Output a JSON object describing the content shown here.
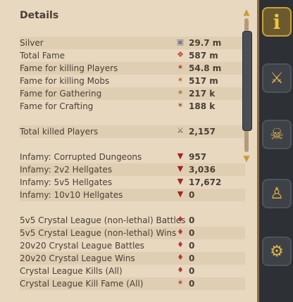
{
  "panel": {
    "title": "Details",
    "rows": [
      {
        "label": "Silver",
        "value": "29.7 m",
        "icon": "silver-icon"
      },
      {
        "label": "Total Fame",
        "value": "587 m",
        "icon": "fame-icon"
      },
      {
        "label": "Fame for killing Players",
        "value": "54.8 m",
        "icon": "pvp-fame-icon"
      },
      {
        "label": "Fame for killing Mobs",
        "value": "517 m",
        "icon": "pve-fame-icon"
      },
      {
        "label": "Fame for Gathering",
        "value": "217 k",
        "icon": "gathering-fame-icon"
      },
      {
        "label": "Fame for Crafting",
        "value": "188 k",
        "icon": "crafting-fame-icon"
      },
      {
        "label": "Total killed Players",
        "value": "2,157",
        "icon": "swords-icon"
      },
      {
        "label": "Infamy: Corrupted Dungeons",
        "value": "957",
        "icon": "infamy-icon"
      },
      {
        "label": "Infamy: 2v2 Hellgates",
        "value": "3,036",
        "icon": "infamy-icon"
      },
      {
        "label": "Infamy: 5v5 Hellgates",
        "value": "17,672",
        "icon": "infamy-icon"
      },
      {
        "label": "Infamy: 10v10 Hellgates",
        "value": "0",
        "icon": "infamy-icon"
      },
      {
        "label": "5v5 Crystal League (non-lethal) Battles",
        "value": "0",
        "icon": "crystal-icon"
      },
      {
        "label": "5v5 Crystal League (non-lethal) Wins",
        "value": "0",
        "icon": "crystal-icon"
      },
      {
        "label": "20v20 Crystal League Battles",
        "value": "0",
        "icon": "crystal-icon"
      },
      {
        "label": "20v20 Crystal League Wins",
        "value": "0",
        "icon": "crystal-icon"
      },
      {
        "label": "Crystal League Kills (All)",
        "value": "0",
        "icon": "crystal-icon"
      },
      {
        "label": "Crystal League Kill Fame (All)",
        "value": "0",
        "icon": "crystal-fame-icon"
      }
    ]
  },
  "sidebar": {
    "buttons": [
      "info-icon",
      "crossed-swords-icon",
      "skull-crossbones-icon",
      "trophy-icon",
      "globe-swords-icon"
    ],
    "info_glyph": "i"
  },
  "colors": {
    "panel_bg": "#e8d8c0",
    "text": "#4a3f35",
    "accent": "#c9a23b"
  }
}
